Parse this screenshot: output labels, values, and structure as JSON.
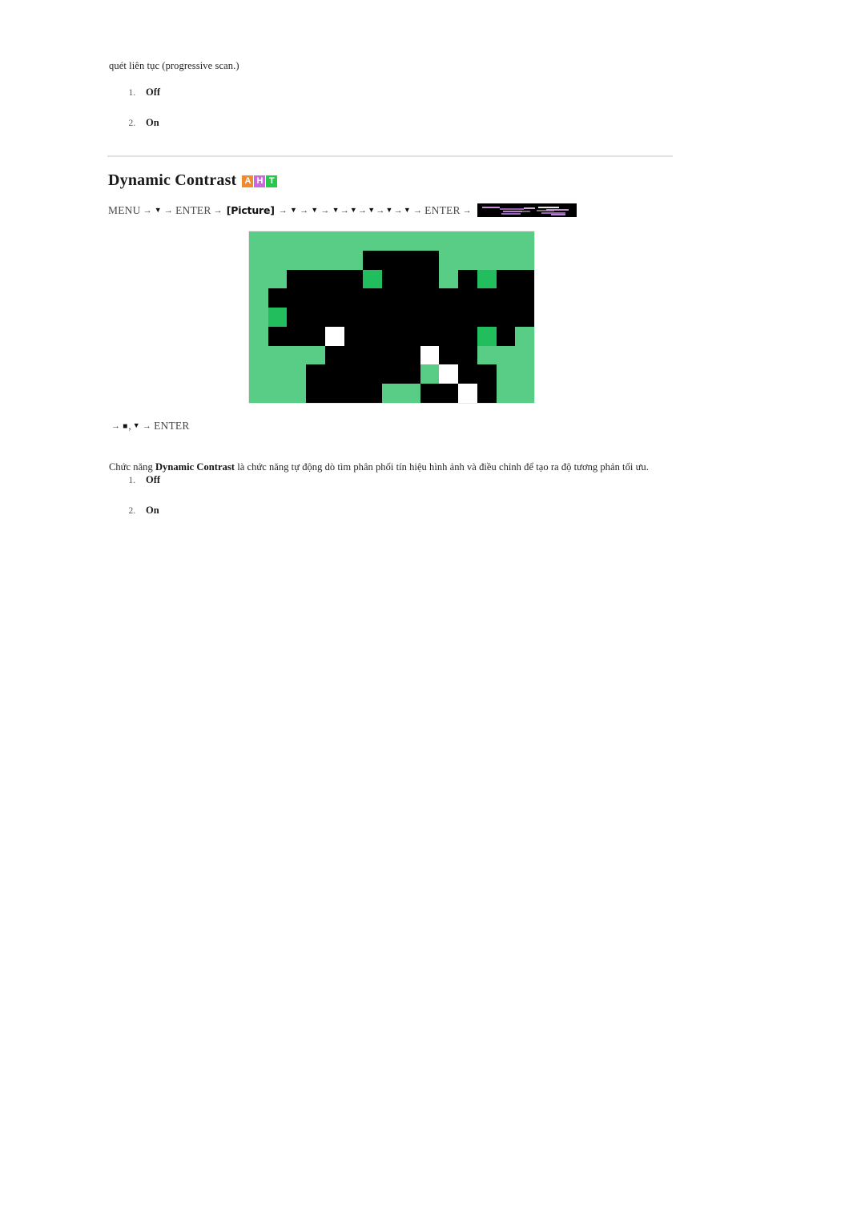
{
  "document": {
    "intro_text": "quét liên tục (progressive scan.)",
    "heading": {
      "title": "Dynamic Contrast",
      "badges": [
        {
          "letter": "A",
          "color": "#f08a2a",
          "name": "badge-analog"
        },
        {
          "letter": "H",
          "color": "#c86adc",
          "name": "badge-hdmi"
        },
        {
          "letter": "T",
          "color": "#28c84a",
          "name": "badge-tv"
        }
      ]
    },
    "menu_path": {
      "start_label": "MENU",
      "arrow": "→",
      "down_glyph": "▼",
      "square_glyph": "■",
      "enter_label": "ENTER",
      "picture_label": "[Picture]",
      "sequence": [
        "MENU",
        "→",
        "▼",
        "→",
        "ENTER",
        "→",
        "[Picture]",
        "→",
        "▼",
        "→",
        "▼",
        "→",
        "▼",
        "→",
        "▼",
        "→",
        "▼",
        "→",
        "▼",
        "→",
        "▼",
        "→",
        "ENTER",
        "→"
      ],
      "osd_thumbnail_alt": "Picture menu OSD thumbnail"
    },
    "sub_path": {
      "sequence": [
        "→",
        "■",
        ",",
        "▼",
        "→",
        "ENTER"
      ],
      "enter_label": "ENTER"
    },
    "description": {
      "prefix": "Chức năng ",
      "bold_term": "Dynamic Contrast",
      "suffix": " là chức năng tự động dò tìm phân phối tín hiệu hình ảnh và điều chỉnh để tạo ra độ tương phản tối ưu."
    },
    "options_top": [
      {
        "index": "1.",
        "label": "Off"
      },
      {
        "index": "2.",
        "label": "On"
      }
    ],
    "options_bottom": [
      {
        "index": "1.",
        "label": "Off"
      },
      {
        "index": "2.",
        "label": "On"
      }
    ],
    "colors": {
      "page_background": "#ffffff",
      "text": "#231f20",
      "divider": "#e3e3e3",
      "image_background_green": "#59cd86",
      "image_accent_green": "#22be5e",
      "image_block_black": "#000000",
      "image_block_white": "#ffffff"
    },
    "pixel_image": {
      "cols": 15,
      "rows": 9,
      "legend": {
        "g": "#59cd86",
        "k": "#000000",
        "d": "#22be5e",
        "w": "#ffffff"
      },
      "grid": [
        "ggggggggggggggg",
        "ggggggkkkkggggg",
        "ggkkkkdkkkgkdkk",
        "gkkkkkkkkkkkkkk",
        "gdkkkkkkkkkkkkk",
        "gkkkwkkkkkkkdkg",
        "ggggkkkkkwkkggg",
        "gggkkkkkkgwkkgg",
        "gggkkkkggkkwkgg"
      ]
    }
  }
}
